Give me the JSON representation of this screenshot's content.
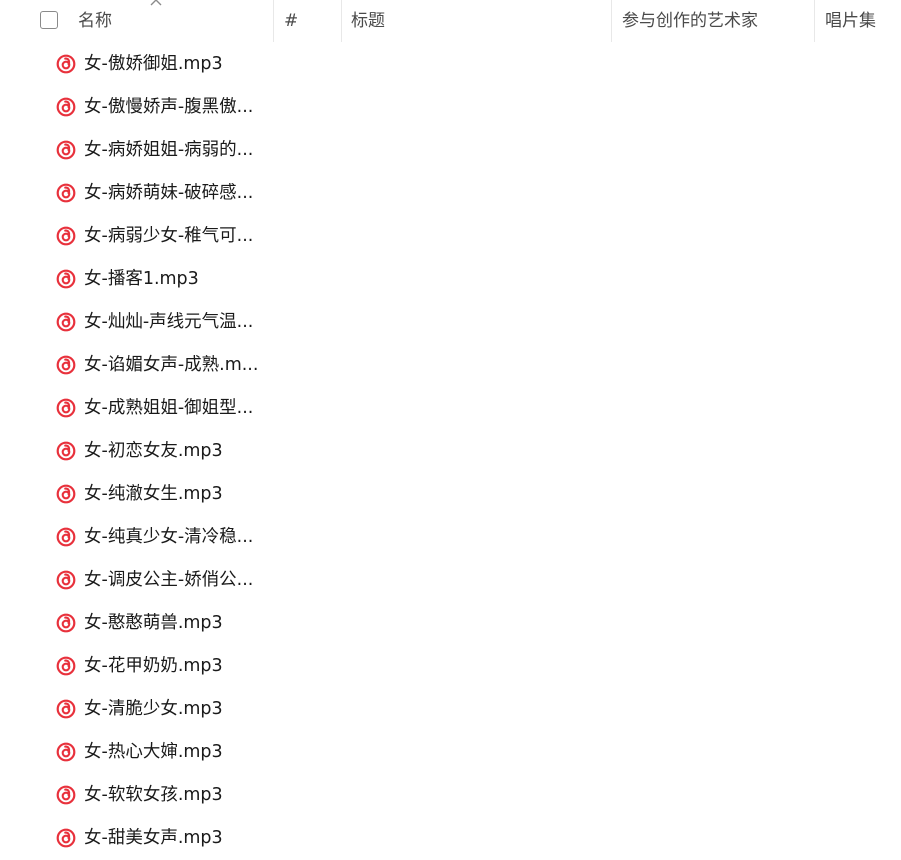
{
  "header": {
    "name_label": "名称",
    "number_label": "#",
    "title_label": "标题",
    "artist_label": "参与创作的艺术家",
    "album_label": "唱片集"
  },
  "icons": {
    "file_icon": "netease-music-icon",
    "sort_icon": "sort-ascending-icon",
    "accent_color": "#e8313c"
  },
  "files": [
    {
      "name": "女-傲娇御姐.mp3"
    },
    {
      "name": "女-傲慢娇声-腹黑傲..."
    },
    {
      "name": "女-病娇姐姐-病弱的..."
    },
    {
      "name": "女-病娇萌妹-破碎感..."
    },
    {
      "name": "女-病弱少女-稚气可..."
    },
    {
      "name": "女-播客1.mp3"
    },
    {
      "name": "女-灿灿-声线元气温..."
    },
    {
      "name": "女-谄媚女声-成熟.m..."
    },
    {
      "name": "女-成熟姐姐-御姐型..."
    },
    {
      "name": "女-初恋女友.mp3"
    },
    {
      "name": "女-纯澈女生.mp3"
    },
    {
      "name": "女-纯真少女-清冷稳..."
    },
    {
      "name": "女-调皮公主-娇俏公..."
    },
    {
      "name": "女-憨憨萌兽.mp3"
    },
    {
      "name": "女-花甲奶奶.mp3"
    },
    {
      "name": "女-清脆少女.mp3"
    },
    {
      "name": "女-热心大婶.mp3"
    },
    {
      "name": "女-软软女孩.mp3"
    },
    {
      "name": "女-甜美女声.mp3"
    }
  ]
}
